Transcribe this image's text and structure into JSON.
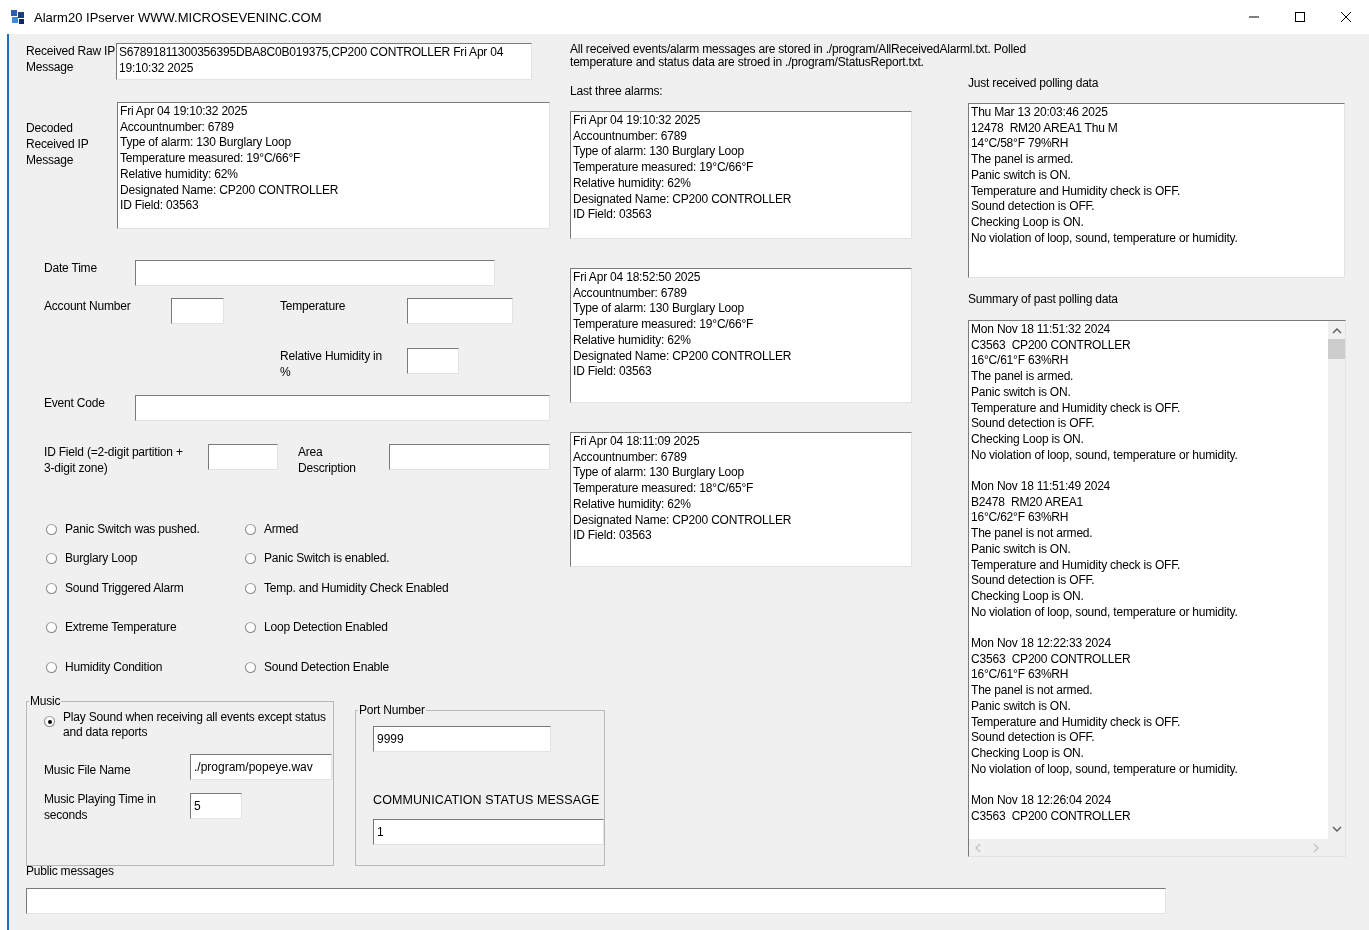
{
  "window": {
    "title": "Alarm20 IPserver  WWW.MICROSEVENINC.COM"
  },
  "raw_message": {
    "label": "Received Raw IP Message",
    "value": "S67891811300356395DBA8C0B019375,CP200 CONTROLLER Fri Apr 04 19:10:32 2025"
  },
  "decoded_message": {
    "label": "Decoded Received IP Message",
    "lines": [
      "Fri Apr 04 19:10:32 2025",
      "Accountnumber: 6789",
      "Type of alarm: 130 Burglary Loop",
      "Temperature measured: 19°C/66°F",
      "Relative humidity: 62%",
      "Designated Name: CP200 CONTROLLER",
      "ID Field: 03563"
    ]
  },
  "fields": {
    "date_time": {
      "label": "Date  Time"
    },
    "account_number": {
      "label": "Account Number"
    },
    "temperature": {
      "label": "Temperature"
    },
    "relative_humidity": {
      "label": "Relative Humidity in %"
    },
    "event_code": {
      "label": "Event Code"
    },
    "id_field": {
      "label": "ID Field (=2-digit partition + 3-digit zone)"
    },
    "area_description": {
      "label": "Area Description"
    }
  },
  "status_options": [
    {
      "label": "Panic Switch was pushed.",
      "selected": false
    },
    {
      "label": "Armed",
      "selected": false
    },
    {
      "label": "Burglary Loop",
      "selected": false
    },
    {
      "label": "Panic Switch is enabled.",
      "selected": false
    },
    {
      "label": "Sound Triggered Alarm",
      "selected": false
    },
    {
      "label": "Temp. and Humidity Check Enabled",
      "selected": false
    },
    {
      "label": "Extreme Temperature",
      "selected": false
    },
    {
      "label": "Loop Detection Enabled",
      "selected": false
    },
    {
      "label": "Humidity Condition",
      "selected": false
    },
    {
      "label": "Sound Detection Enable",
      "selected": false
    }
  ],
  "music": {
    "title": "Music",
    "play_sound": {
      "label": "Play Sound when receiving  all events except status and data reports",
      "selected": true
    },
    "file_label": "Music File Name",
    "file_value": "./program/popeye.wav",
    "time_label": "Music Playing Time in seconds",
    "time_value": "5"
  },
  "port": {
    "title": "Port Number",
    "value": "9999",
    "status_label": "COMMUNICATION STATUS MESSAGE",
    "status_value": "1"
  },
  "storage_note": "All received events/alarm messages are stored in ./program/AllReceivedAlarml.txt. Polled temperature and status data are stroed in ./program/StatusReport.txt.",
  "last_alarms": {
    "label": "Last three alarms:",
    "alarms": [
      {
        "lines": [
          "Fri Apr 04 19:10:32 2025",
          "Accountnumber: 6789",
          "Type of alarm: 130 Burglary Loop",
          "Temperature measured: 19°C/66°F",
          "Relative humidity: 62%",
          "Designated Name: CP200 CONTROLLER",
          "ID Field: 03563"
        ]
      },
      {
        "lines": [
          "Fri Apr 04 18:52:50 2025",
          "Accountnumber: 6789",
          "Type of alarm: 130 Burglary Loop",
          "Temperature measured: 19°C/66°F",
          "Relative humidity: 62%",
          "Designated Name: CP200 CONTROLLER",
          "ID Field: 03563"
        ]
      },
      {
        "lines": [
          "Fri Apr 04 18:11:09 2025",
          "Accountnumber: 6789",
          "Type of alarm: 130 Burglary Loop",
          "Temperature measured: 18°C/65°F",
          "Relative humidity: 62%",
          "Designated Name: CP200 CONTROLLER",
          "ID Field: 03563"
        ]
      }
    ]
  },
  "polling": {
    "label": "Just received polling data",
    "lines": [
      "Thu Mar 13 20:03:46 2025",
      "12478  RM20 AREA1 Thu M",
      "14°C/58°F 79%RH",
      "The panel is armed.",
      "Panic switch is ON.",
      "Temperature and Humidity check is OFF.",
      "Sound detection is OFF.",
      "Checking Loop is ON.",
      "No violation of loop, sound, temperature or humidity."
    ]
  },
  "summary": {
    "label": "Summary of past polling data",
    "entries": [
      {
        "lines": [
          "Mon Nov 18 11:51:32 2024",
          "C3563  CP200 CONTROLLER",
          "16°C/61°F 63%RH",
          "The panel is armed.",
          "Panic switch is ON.",
          "Temperature and Humidity check is OFF.",
          "Sound detection is OFF.",
          "Checking Loop is ON.",
          "No violation of loop, sound, temperature or humidity."
        ]
      },
      {
        "lines": [
          "Mon Nov 18 11:51:49 2024",
          "B2478  RM20 AREA1",
          "16°C/62°F 63%RH",
          "The panel is not armed.",
          "Panic switch is ON.",
          "Temperature and Humidity check is OFF.",
          "Sound detection is OFF.",
          "Checking Loop is ON.",
          "No violation of loop, sound, temperature or humidity."
        ]
      },
      {
        "lines": [
          "Mon Nov 18 12:22:33 2024",
          "C3563  CP200 CONTROLLER",
          "16°C/61°F 63%RH",
          "The panel is not armed.",
          "Panic switch is ON.",
          "Temperature and Humidity check is OFF.",
          "Sound detection is OFF.",
          "Checking Loop is ON.",
          "No violation of loop, sound, temperature or humidity."
        ]
      },
      {
        "lines": [
          "Mon Nov 18 12:26:04 2024",
          "C3563  CP200 CONTROLLER"
        ]
      }
    ]
  },
  "public_messages": {
    "label": "Public messages"
  }
}
